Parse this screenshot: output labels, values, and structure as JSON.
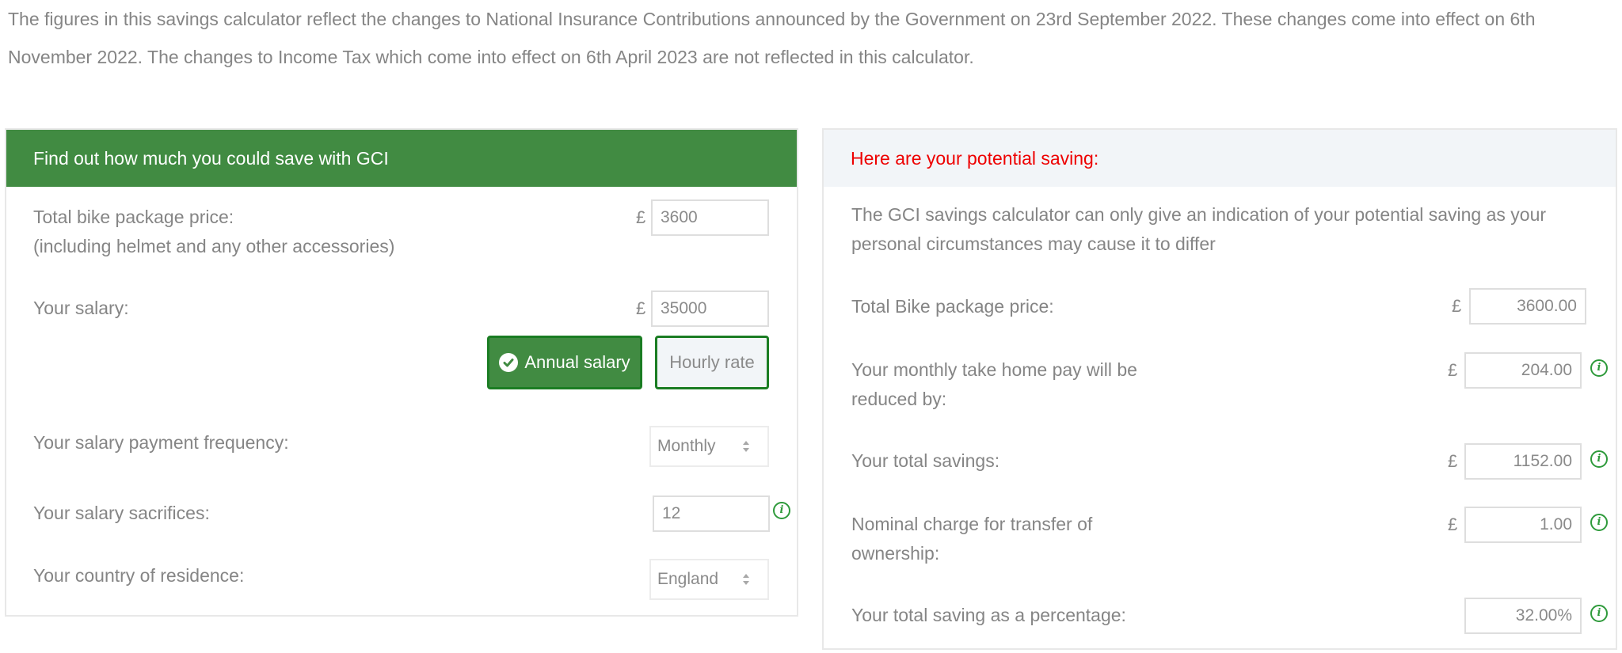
{
  "notice": {
    "text": "The figures in this savings calculator reflect the changes to National Insurance Contributions announced by the Government on 23rd September 2022. These changes come into effect on 6th November 2022. The changes to Income Tax which come into effect on 6th April 2023 are not reflected in this calculator."
  },
  "calculator": {
    "header": "Find out how much you could save with GCI",
    "bike_price": {
      "label_line1": "Total bike package price:",
      "label_line2": "(including helmet and any other accessories)",
      "currency": "£",
      "value": "3600"
    },
    "salary": {
      "label": "Your salary:",
      "currency": "£",
      "value": "35000",
      "toggle": {
        "annual_label": "Annual salary",
        "hourly_label": "Hourly rate",
        "selected": "Annual salary"
      }
    },
    "frequency": {
      "label": "Your salary payment frequency:",
      "selected": "Monthly"
    },
    "sacrifices": {
      "label": "Your salary sacrifices:",
      "value": "12"
    },
    "country": {
      "label": "Your country of residence:",
      "selected": "England"
    }
  },
  "results": {
    "header": "Here are your potential saving:",
    "disclaimer_line1": "The GCI savings calculator can only give an indication of your potential saving as your",
    "disclaimer_line2": "personal circumstances may cause it to differ",
    "bike_price": {
      "label": "Total Bike package price:",
      "currency": "£",
      "value": "3600.00"
    },
    "monthly_reduction": {
      "label_line1": "Your monthly take home pay will be",
      "label_line2": "reduced by:",
      "currency": "£",
      "value": "204.00"
    },
    "total_savings": {
      "label": "Your total savings:",
      "currency": "£",
      "value": "1152.00"
    },
    "transfer_charge": {
      "label_line1": "Nominal charge for transfer of",
      "label_line2": "ownership:",
      "currency": "£",
      "value": "1.00"
    },
    "saving_percentage": {
      "label": "Your total saving as a percentage:",
      "value": "32.00%"
    }
  },
  "colors": {
    "brand_green": "#418b42",
    "button_border_green": "#1b7d23",
    "info_icon_green": "#2e9a3b",
    "results_header_red": "#ee0000",
    "results_header_bg": "#f2f5f8"
  }
}
